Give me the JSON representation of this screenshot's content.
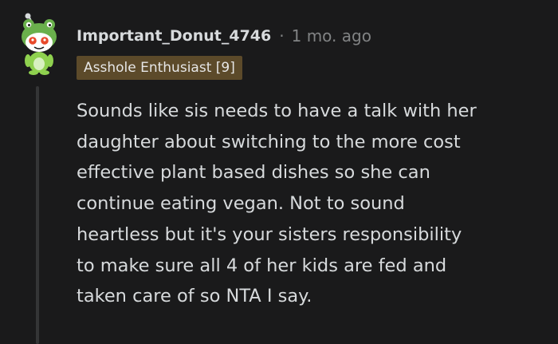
{
  "comment": {
    "username": "Important_Donut_4746",
    "separator": "·",
    "timestamp": "1 mo. ago",
    "flair": "Asshole Enthusiast [9]",
    "body_lines": [
      "Sounds like sis needs to have a talk with her",
      "daughter about switching to the more cost",
      "effective plant based dishes so she can",
      "continue eating vegan. Not to sound",
      "heartless but it's your sisters responsibility",
      "to make sure all 4 of her kids are fed and",
      "taken care of so NTA I say."
    ]
  },
  "avatar": {
    "icon": "snoo-frog-hat-avatar",
    "colors": {
      "hat": "#6ab04c",
      "face": "#ffffff",
      "eyes": "#e8492b",
      "body": "#8fd14f",
      "background": "#1a1a1b"
    }
  },
  "colors": {
    "background": "#1a1a1b",
    "text": "#d7dadc",
    "meta": "#818384",
    "flair_bg": "#5c4a2a",
    "thread_line": "#343536"
  }
}
